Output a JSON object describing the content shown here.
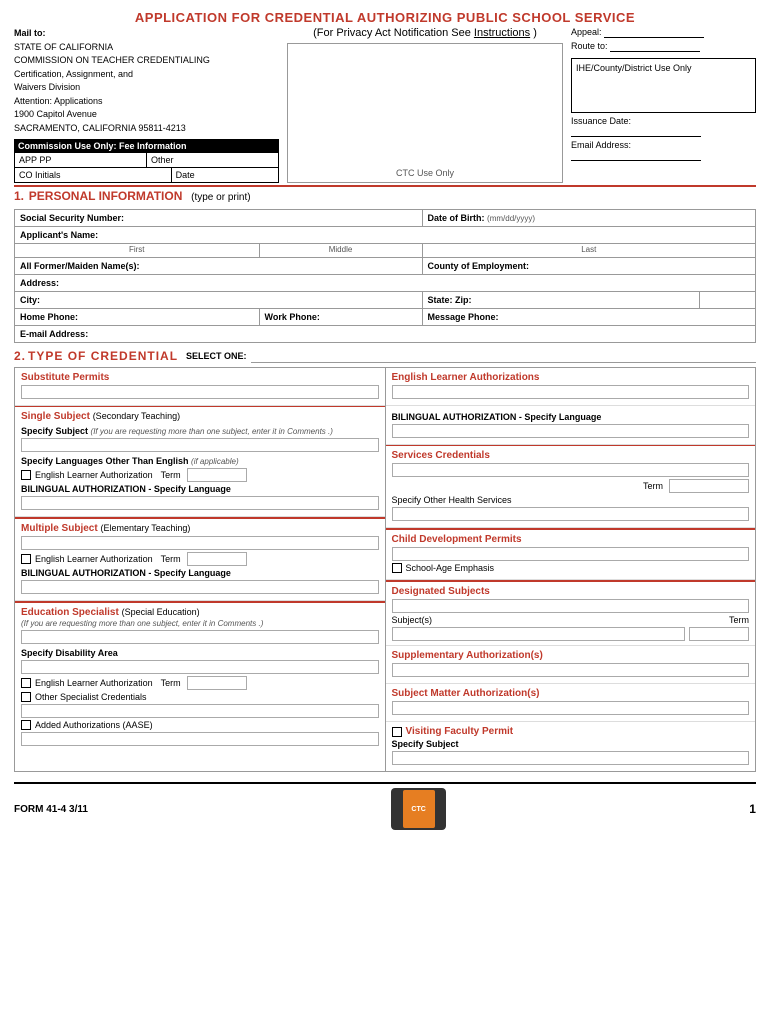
{
  "header": {
    "title": "APPLICATION FOR CREDENTIAL AUTHORIZING PUBLIC SCHOOL SERVICE",
    "subtitle": "(For Privacy Act Notification See",
    "subtitle_link": "Instructions",
    "subtitle_end": ")",
    "appeal_label": "Appeal:",
    "route_label": "Route to:",
    "ihe_text": "IHE/County/District Use Only",
    "issuance_label": "Issuance Date:",
    "email_label": "Email Address:"
  },
  "mail_to": {
    "label": "Mail to:",
    "line1": "STATE OF CALIFORNIA",
    "line2": "COMMISSION ON TEACHER CREDENTIALING",
    "line3": "Certification, Assignment, and",
    "line4": "Waivers Division",
    "line5": "Attention: Applications",
    "line6": "1900 Capitol Avenue",
    "line7": "SACRAMENTO, CALIFORNIA 95811-4213"
  },
  "fee_box": {
    "header": "Commission Use Only: Fee Information",
    "app_pp": "APP PP",
    "other": "Other",
    "co_initials": "CO Initials",
    "date": "Date"
  },
  "ctc_use": "CTC Use Only",
  "section1": {
    "number": "1.",
    "title": "PERSONAL INFORMATION",
    "subtitle": "(type or print)"
  },
  "personal_fields": {
    "ssn": "Social Security Number:",
    "dob": "Date of Birth:",
    "dob_format": "(mm/dd/yyyy)",
    "applicant_name": "Applicant's Name:",
    "first": "First",
    "middle": "Middle",
    "last": "Last",
    "former_names": "All Former/Maiden Name(s):",
    "county": "County of Employment:",
    "address": "Address:",
    "city": "City:",
    "state_zip": "State: Zip:",
    "home_phone": "Home Phone:",
    "work_phone": "Work Phone:",
    "message_phone": "Message Phone:",
    "email": "E-mail Address:"
  },
  "section2": {
    "number": "2.",
    "title": "TYPE OF CREDENTIAL",
    "select_one": "SELECT ONE:"
  },
  "left_column": {
    "substitute_permits": {
      "title": "Substitute Permits"
    },
    "single_subject": {
      "title": "Single Subject",
      "subtitle": "(Secondary Teaching)"
    },
    "specify_subject": {
      "title": "Specify Subject",
      "subtitle": "(If you are requesting more than one subject, enter it in",
      "subtitle2": "Comments",
      "subtitle3": ".)"
    },
    "specify_languages": {
      "title": "Specify Languages Other Than English",
      "subtitle": "(if applicable)"
    },
    "english_learner_auth": "English Learner Authorization",
    "term": "Term",
    "bilingual_auth": "BILINGUAL AUTHORIZATION - Specify Language",
    "multiple_subject": {
      "title": "Multiple Subject",
      "subtitle": "(Elementary Teaching)"
    },
    "english_learner_auth2": "English Learner Authorization",
    "term2": "Term",
    "bilingual_auth2": "BILINGUAL AUTHORIZATION - Specify Language",
    "education_specialist": {
      "title": "Education Specialist",
      "subtitle": "(Special Education)",
      "note": "(If you are requesting more than one subject, enter it in",
      "note2": "Comments",
      "note3": ".)"
    },
    "specify_disability": "Specify Disability Area",
    "english_learner_auth3": "English Learner Authorization",
    "term3": "Term",
    "other_specialist": "Other Specialist Credentials",
    "added_auth": "Added Authorizations (AASE)"
  },
  "right_column": {
    "english_learner_auth": {
      "title": "English Learner Authorizations"
    },
    "bilingual_auth": {
      "title": "BILINGUAL AUTHORIZATION - Specify Language"
    },
    "services_credentials": {
      "title": "Services Credentials",
      "term": "Term"
    },
    "specify_other_health": "Specify Other Health Services",
    "child_development": {
      "title": "Child Development Permits"
    },
    "school_age": "School-Age Emphasis",
    "designated_subjects": {
      "title": "Designated Subjects"
    },
    "subjects_label": "Subject(s)",
    "term_label": "Term",
    "supplementary_auth": {
      "title": "Supplementary Authorization(s)"
    },
    "subject_matter_auth": {
      "title": "Subject Matter Authorization(s)"
    },
    "visiting_faculty": {
      "title": "Visiting Faculty Permit"
    },
    "specify_subject": "Specify Subject"
  },
  "footer": {
    "form_number": "FORM 41-4  3/11",
    "page_number": "1"
  }
}
